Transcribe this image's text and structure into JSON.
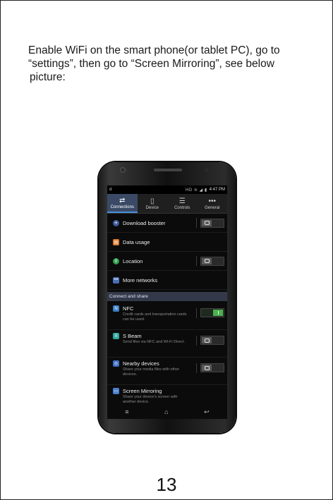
{
  "instructions": {
    "line1": "Enable WiFi on the smart phone(or tablet PC), go to",
    "line2": "“settings”, then go to “Screen Mirroring”, see below",
    "line3": "picture:"
  },
  "page_number": "13",
  "phone": {
    "status_bar": {
      "notification": "σ",
      "time": "4:47 PM",
      "icons": "HD ≋ ◢ ▮"
    },
    "tabs": [
      {
        "label": "Connections",
        "icon": "swap-arrows-icon",
        "glyph": "⇄",
        "active": true
      },
      {
        "label": "Device",
        "icon": "phone-icon",
        "glyph": "▯",
        "active": false
      },
      {
        "label": "Controls",
        "icon": "sliders-icon",
        "glyph": "☰",
        "active": false
      },
      {
        "label": "General",
        "icon": "more-dots-icon",
        "glyph": "•••",
        "active": false
      }
    ],
    "items": [
      {
        "label": "Download booster",
        "icon": "rocket-icon",
        "glyph": "✈",
        "color": "#3d5a9e",
        "toggle": "off"
      },
      {
        "label": "Data usage",
        "icon": "chart-icon",
        "glyph": "▤",
        "color": "#e07b2a",
        "toggle": null
      },
      {
        "label": "Location",
        "icon": "location-pin-icon",
        "glyph": "⚲",
        "color": "#2e9e4a",
        "toggle": "off"
      },
      {
        "label": "More networks",
        "icon": "more-icon",
        "glyph": "•••",
        "color": "#4a6fb5",
        "toggle": null
      }
    ],
    "section_header": "Connect and share",
    "share_items": [
      {
        "label": "NFC",
        "desc": "Credit cards and transportation cards can be used.",
        "icon": "nfc-icon",
        "glyph": "N",
        "color": "#3b7fc4",
        "toggle": "on"
      },
      {
        "label": "S Beam",
        "desc": "Send files via NFC and Wi-Fi Direct.",
        "icon": "beam-icon",
        "glyph": "S",
        "color": "#2fa7a0",
        "toggle": "off"
      },
      {
        "label": "Nearby devices",
        "desc": "Share your media files with other devices.",
        "icon": "nearby-devices-icon",
        "glyph": "◎",
        "color": "#3b6fc4",
        "toggle": "off"
      },
      {
        "label": "Screen Mirroring",
        "desc": "Share your device's screen with another device.",
        "icon": "screen-mirroring-icon",
        "glyph": "▭",
        "color": "#4a7fd0",
        "toggle": null
      }
    ],
    "nav": {
      "menu": "≡",
      "home": "⌂",
      "back": "↩"
    }
  }
}
